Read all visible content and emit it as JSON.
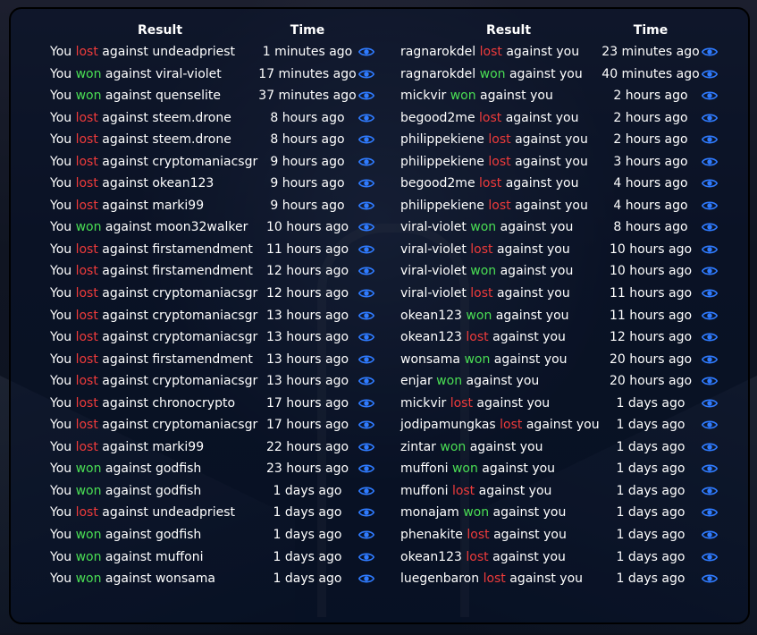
{
  "headers": {
    "result": "Result",
    "time": "Time"
  },
  "left_rows": [
    {
      "prefix": "You ",
      "outcome": "lost",
      "suffix": " against undeadpriest",
      "time": "1 minutes ago"
    },
    {
      "prefix": "You ",
      "outcome": "won",
      "suffix": " against viral-violet",
      "time": "17 minutes ago"
    },
    {
      "prefix": "You ",
      "outcome": "won",
      "suffix": " against quenselite",
      "time": "37 minutes ago"
    },
    {
      "prefix": "You ",
      "outcome": "lost",
      "suffix": " against steem.drone",
      "time": "8 hours ago"
    },
    {
      "prefix": "You ",
      "outcome": "lost",
      "suffix": " against steem.drone",
      "time": "8 hours ago"
    },
    {
      "prefix": "You ",
      "outcome": "lost",
      "suffix": " against cryptomaniacsgr",
      "time": "9 hours ago"
    },
    {
      "prefix": "You ",
      "outcome": "lost",
      "suffix": " against okean123",
      "time": "9 hours ago"
    },
    {
      "prefix": "You ",
      "outcome": "lost",
      "suffix": " against marki99",
      "time": "9 hours ago"
    },
    {
      "prefix": "You ",
      "outcome": "won",
      "suffix": " against moon32walker",
      "time": "10 hours ago"
    },
    {
      "prefix": "You ",
      "outcome": "lost",
      "suffix": " against firstamendment",
      "time": "11 hours ago"
    },
    {
      "prefix": "You ",
      "outcome": "lost",
      "suffix": " against firstamendment",
      "time": "12 hours ago"
    },
    {
      "prefix": "You ",
      "outcome": "lost",
      "suffix": " against cryptomaniacsgr",
      "time": "12 hours ago"
    },
    {
      "prefix": "You ",
      "outcome": "lost",
      "suffix": " against cryptomaniacsgr",
      "time": "13 hours ago"
    },
    {
      "prefix": "You ",
      "outcome": "lost",
      "suffix": " against cryptomaniacsgr",
      "time": "13 hours ago"
    },
    {
      "prefix": "You ",
      "outcome": "lost",
      "suffix": " against firstamendment",
      "time": "13 hours ago"
    },
    {
      "prefix": "You ",
      "outcome": "lost",
      "suffix": " against cryptomaniacsgr",
      "time": "13 hours ago"
    },
    {
      "prefix": "You ",
      "outcome": "lost",
      "suffix": " against chronocrypto",
      "time": "17 hours ago"
    },
    {
      "prefix": "You ",
      "outcome": "lost",
      "suffix": " against cryptomaniacsgr",
      "time": "17 hours ago"
    },
    {
      "prefix": "You ",
      "outcome": "lost",
      "suffix": " against marki99",
      "time": "22 hours ago"
    },
    {
      "prefix": "You ",
      "outcome": "won",
      "suffix": " against godfish",
      "time": "23 hours ago"
    },
    {
      "prefix": "You ",
      "outcome": "won",
      "suffix": " against godfish",
      "time": "1 days ago"
    },
    {
      "prefix": "You ",
      "outcome": "lost",
      "suffix": " against undeadpriest",
      "time": "1 days ago"
    },
    {
      "prefix": "You ",
      "outcome": "won",
      "suffix": " against godfish",
      "time": "1 days ago"
    },
    {
      "prefix": "You ",
      "outcome": "won",
      "suffix": " against muffoni",
      "time": "1 days ago"
    },
    {
      "prefix": "You ",
      "outcome": "won",
      "suffix": " against wonsama",
      "time": "1 days ago"
    }
  ],
  "right_rows": [
    {
      "prefix": "ragnarokdel ",
      "outcome": "lost",
      "suffix": " against you",
      "time": "23 minutes ago"
    },
    {
      "prefix": "ragnarokdel ",
      "outcome": "won",
      "suffix": " against you",
      "time": "40 minutes ago"
    },
    {
      "prefix": "mickvir ",
      "outcome": "won",
      "suffix": " against you",
      "time": "2 hours ago"
    },
    {
      "prefix": "begood2me ",
      "outcome": "lost",
      "suffix": " against you",
      "time": "2 hours ago"
    },
    {
      "prefix": "philippekiene ",
      "outcome": "lost",
      "suffix": " against you",
      "time": "2 hours ago"
    },
    {
      "prefix": "philippekiene ",
      "outcome": "lost",
      "suffix": " against you",
      "time": "3 hours ago"
    },
    {
      "prefix": "begood2me ",
      "outcome": "lost",
      "suffix": " against you",
      "time": "4 hours ago"
    },
    {
      "prefix": "philippekiene ",
      "outcome": "lost",
      "suffix": " against you",
      "time": "4 hours ago"
    },
    {
      "prefix": "viral-violet ",
      "outcome": "won",
      "suffix": " against you",
      "time": "8 hours ago"
    },
    {
      "prefix": "viral-violet ",
      "outcome": "lost",
      "suffix": " against you",
      "time": "10 hours ago"
    },
    {
      "prefix": "viral-violet ",
      "outcome": "won",
      "suffix": " against you",
      "time": "10 hours ago"
    },
    {
      "prefix": "viral-violet ",
      "outcome": "lost",
      "suffix": " against you",
      "time": "11 hours ago"
    },
    {
      "prefix": "okean123 ",
      "outcome": "won",
      "suffix": " against you",
      "time": "11 hours ago"
    },
    {
      "prefix": "okean123 ",
      "outcome": "lost",
      "suffix": " against you",
      "time": "12 hours ago"
    },
    {
      "prefix": "wonsama ",
      "outcome": "won",
      "suffix": " against you",
      "time": "20 hours ago"
    },
    {
      "prefix": "enjar ",
      "outcome": "won",
      "suffix": " against you",
      "time": "20 hours ago"
    },
    {
      "prefix": "mickvir ",
      "outcome": "lost",
      "suffix": " against you",
      "time": "1 days ago"
    },
    {
      "prefix": "jodipamungkas ",
      "outcome": "lost",
      "suffix": " against you",
      "time": "1 days ago"
    },
    {
      "prefix": "zintar ",
      "outcome": "won",
      "suffix": " against you",
      "time": "1 days ago"
    },
    {
      "prefix": "muffoni ",
      "outcome": "won",
      "suffix": " against you",
      "time": "1 days ago"
    },
    {
      "prefix": "muffoni ",
      "outcome": "lost",
      "suffix": " against you",
      "time": "1 days ago"
    },
    {
      "prefix": "monajam ",
      "outcome": "won",
      "suffix": " against you",
      "time": "1 days ago"
    },
    {
      "prefix": "phenakite ",
      "outcome": "lost",
      "suffix": " against you",
      "time": "1 days ago"
    },
    {
      "prefix": "okean123 ",
      "outcome": "lost",
      "suffix": " against you",
      "time": "1 days ago"
    },
    {
      "prefix": "luegenbaron ",
      "outcome": "lost",
      "suffix": " against you",
      "time": "1 days ago"
    }
  ],
  "colors": {
    "won": "#4ade54",
    "lost": "#ef3b3b",
    "eye": "#2f7bff"
  },
  "icons": {
    "view": "eye-icon"
  }
}
